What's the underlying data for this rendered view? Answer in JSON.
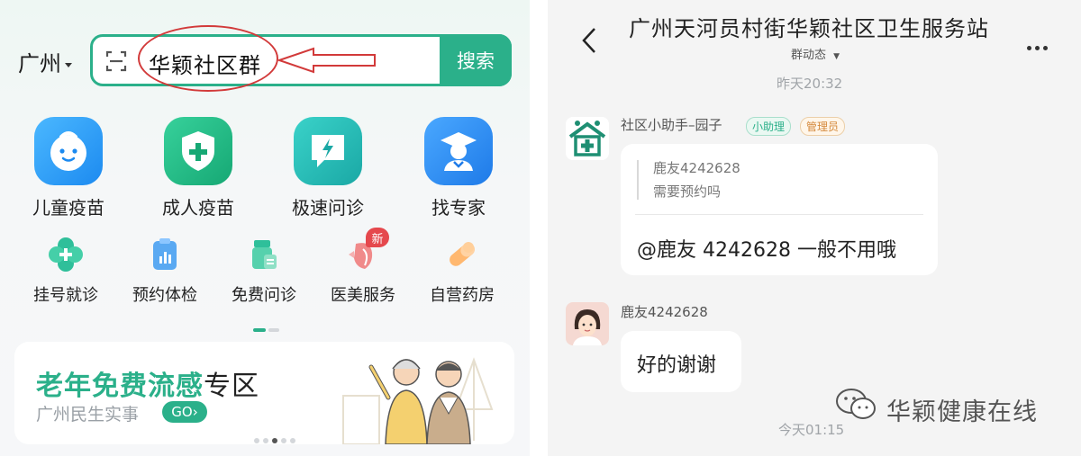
{
  "left": {
    "city": "广州",
    "search": {
      "query": "华颖社区群",
      "button_label": "搜索"
    },
    "main_services": [
      {
        "label": "儿童疫苗",
        "icon": "child-face-icon"
      },
      {
        "label": "成人疫苗",
        "icon": "shield-plus-icon"
      },
      {
        "label": "极速问诊",
        "icon": "chat-lightning-icon"
      },
      {
        "label": "找专家",
        "icon": "doctor-icon"
      }
    ],
    "sub_services": [
      {
        "label": "挂号就诊",
        "icon": "clover-cross-icon"
      },
      {
        "label": "预约体检",
        "icon": "clipboard-chart-icon"
      },
      {
        "label": "免费问诊",
        "icon": "medicine-bottle-icon"
      },
      {
        "label": "医美服务",
        "icon": "face-beauty-icon"
      },
      {
        "label": "自营药房",
        "icon": "pill-capsule-icon"
      }
    ],
    "new_badge": "新",
    "banner": {
      "title_highlight": "老年免费流感",
      "title_rest": "专区",
      "subtitle": "广州民生实事",
      "go_label": "GO"
    },
    "colors": {
      "accent": "#2bb08a",
      "annotation": "#d23a3a"
    }
  },
  "right": {
    "title": "广州天河员村街华颖社区卫生服务站",
    "group_dynamics": "群动态",
    "timestamp_1": "昨天20:32",
    "assistant": {
      "name": "社区小助手–园子",
      "tag_assistant": "小助理",
      "tag_admin": "管理员"
    },
    "quote": {
      "author": "鹿友4242628",
      "text": "需要预约吗"
    },
    "reply_text": "@鹿友 4242628  一般不用哦",
    "user": {
      "name": "鹿友4242628",
      "message": "好的谢谢"
    },
    "timestamp_2": "今天01:15",
    "watermark": "华颖健康在线"
  }
}
